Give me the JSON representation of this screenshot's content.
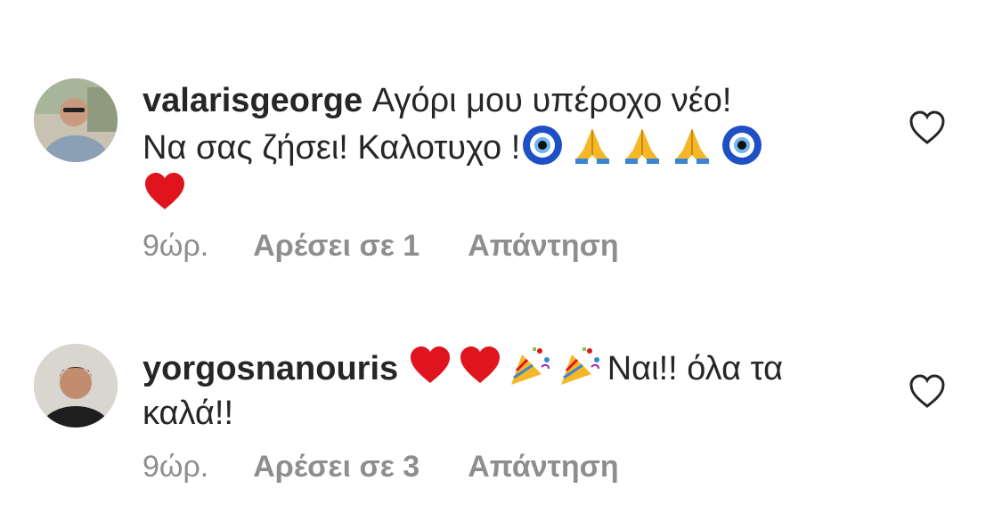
{
  "comments": [
    {
      "username": "valarisgeorge",
      "text_line1": " Αγόρι μου υπέροχο νέο!",
      "text_line2": "Να σας ζήσει! Καλοτυχο !",
      "emojis": [
        "nazar-amulet-icon",
        "folded-hands-icon",
        "folded-hands-icon",
        "folded-hands-icon",
        "nazar-amulet-icon",
        "red-heart-icon"
      ],
      "time": "9ώρ.",
      "likes": "Αρέσει σε 1",
      "reply": "Απάντηση"
    },
    {
      "username": "yorgosnanouris",
      "emojis": [
        "red-heart-icon",
        "red-heart-icon",
        "party-popper-icon",
        "party-popper-icon"
      ],
      "text_line1": "Ναι!! όλα τα",
      "text_line2": "καλά!!",
      "time": "9ώρ.",
      "likes": "Αρέσει σε 3",
      "reply": "Απάντηση"
    }
  ],
  "colors": {
    "text": "#262626",
    "meta": "#8e8e8e",
    "heart_red": "#e0141e"
  }
}
